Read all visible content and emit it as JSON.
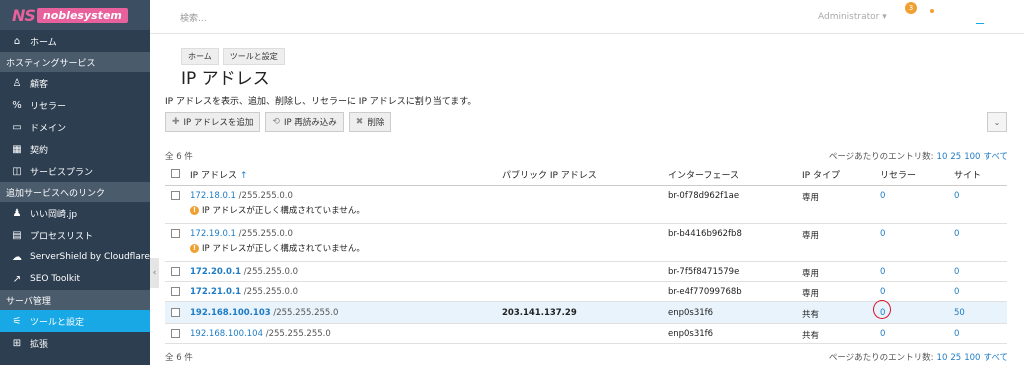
{
  "brand": {
    "mark": "NS",
    "name": "noblesystem"
  },
  "nav": {
    "home": "ホーム",
    "section_hosting": "ホスティングサービス",
    "customers": "顧客",
    "resellers": "リセラー",
    "domains": "ドメイン",
    "subscriptions": "契約",
    "service_plans": "サービスプラン",
    "section_links": "追加サービスへのリンク",
    "link1": "いい岡崎.jp",
    "link2": "プロセスリスト",
    "link3": "ServerShield by Cloudflare",
    "link4": "SEO Toolkit",
    "section_server": "サーバ管理",
    "tools": "ツールと設定",
    "extensions": "拡張"
  },
  "topbar": {
    "search_placeholder": "検索...",
    "user": "Administrator ▾",
    "badge": "3"
  },
  "breadcrumb": [
    "ホーム",
    "ツールと設定"
  ],
  "page": {
    "title": "IP アドレス",
    "description": "IP アドレスを表示、追加、削除し、リセラーに IP アドレスに割り当てます。"
  },
  "toolbar": {
    "add": "IP アドレスを追加",
    "reread": "IP 再読み込み",
    "delete": "削除"
  },
  "list": {
    "total": "全 6 件",
    "per_page_label": "ページあたりのエントリ数:",
    "per_page_options": [
      "10",
      "25",
      "100",
      "すべて"
    ]
  },
  "table": {
    "headers": {
      "ip": "IP アドレス",
      "public_ip": "パブリック IP アドレス",
      "interface": "インターフェース",
      "type": "IP タイプ",
      "reseller": "リセラー",
      "site": "サイト"
    },
    "warning": "IP アドレスが正しく構成されていません。",
    "rows": [
      {
        "ip": "172.18.0.1",
        "mask": " /255.255.0.0",
        "public": "",
        "iface": "br-0f78d962f1ae",
        "type": "専用",
        "reseller": "0",
        "site": "0"
      },
      {
        "ip": "172.19.0.1",
        "mask": " /255.255.0.0",
        "public": "",
        "iface": "br-b4416b962fb8",
        "type": "専用",
        "reseller": "0",
        "site": "0"
      },
      {
        "ip": "172.20.0.1",
        "mask": " /255.255.0.0",
        "public": "",
        "iface": "br-7f5f8471579e",
        "type": "専用",
        "reseller": "0",
        "site": "0"
      },
      {
        "ip": "172.21.0.1",
        "mask": " /255.255.0.0",
        "public": "",
        "iface": "br-e4f77099768b",
        "type": "専用",
        "reseller": "0",
        "site": "0"
      },
      {
        "ip": "192.168.100.103",
        "mask": " /255.255.255.0",
        "public": "203.141.137.29",
        "iface": "enp0s31f6",
        "type": "共有",
        "reseller": "0",
        "site": "50"
      },
      {
        "ip": "192.168.100.104",
        "mask": " /255.255.255.0",
        "public": "",
        "iface": "enp0s31f6",
        "type": "共有",
        "reseller": "0",
        "site": "0"
      }
    ]
  }
}
